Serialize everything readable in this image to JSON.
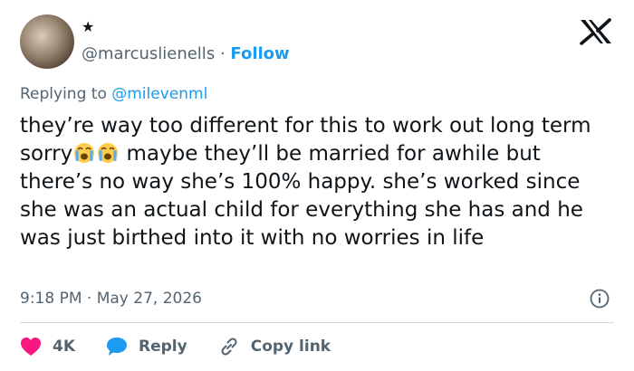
{
  "author": {
    "badge": "★",
    "handle": "@marcuslienells",
    "separator": "·",
    "follow_label": "Follow"
  },
  "replying": {
    "prefix": "Replying to",
    "mention": "@milevenml"
  },
  "tweet": {
    "text_part1": "they’re way too different for this to work out long term sorry",
    "text_part2": " maybe they’ll be married for awhile but there’s no way she’s 100% happy. she’s worked since she was an actual child for everything she has and he was just birthed into it with no worries in life",
    "emojis": [
      "crying-face-emoji",
      "crying-face-emoji"
    ]
  },
  "meta": {
    "time": "9:18 PM",
    "separator": "·",
    "date": "May 27, 2026"
  },
  "actions": {
    "likes": "4K",
    "reply_label": "Reply",
    "copy_label": "Copy link"
  },
  "colors": {
    "link": "#1d9bf0",
    "like": "#f91880",
    "muted": "#536471",
    "text": "#0f1419"
  }
}
